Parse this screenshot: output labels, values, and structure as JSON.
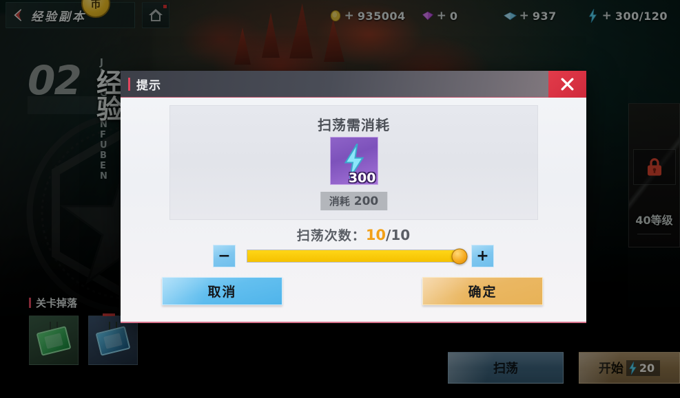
{
  "topbar": {
    "back_label": "经验副本",
    "back_icon": "chevron-left-icon",
    "home_icon": "home-icon",
    "coin_badge": "币",
    "currencies": [
      {
        "icon": "gold-coin-icon",
        "plus": "+",
        "value": "935004"
      },
      {
        "icon": "purple-gem-icon",
        "plus": "+",
        "value": "0"
      },
      {
        "icon": "blue-diamond-icon",
        "plus": "+",
        "value": "937"
      },
      {
        "icon": "energy-bolt-icon",
        "plus": "+",
        "value": "300/120"
      }
    ]
  },
  "stage": {
    "pinyin": "J I N G   Y A N   F U   B E N",
    "number": "02",
    "name": "经验",
    "locked_cards": [
      {
        "label": "锁",
        "lock_icon": "lock-icon"
      },
      {
        "label": "40等级",
        "lock_icon": "lock-icon"
      }
    ]
  },
  "drops": {
    "title": "关卡掉落",
    "items": [
      {
        "name": "green-chip-item"
      },
      {
        "name": "blue-chip-item"
      }
    ]
  },
  "bottom": {
    "sweep_label": "扫荡",
    "start_label": "开始",
    "start_cost_icon": "energy-bolt-icon",
    "start_cost": "20"
  },
  "dialog": {
    "title": "提示",
    "close_icon": "close-icon",
    "cost_title": "扫荡需消耗",
    "cost_icon": "energy-bolt-icon",
    "cost_icon_count": "300",
    "cost_badge_label": "消耗",
    "cost_badge_value": "200",
    "count_label": "扫荡次数：",
    "count_current": "10",
    "count_separator": "/",
    "count_max": "10",
    "minus_label": "−",
    "plus_label": "+",
    "slider_percent": 100,
    "cancel_label": "取消",
    "confirm_label": "确定"
  },
  "colors": {
    "accent_red": "#e2465f",
    "gold": "#f2a017",
    "confirm": "#eab762",
    "cancel": "#63bfef",
    "energy_purple": "#7d52bb"
  }
}
